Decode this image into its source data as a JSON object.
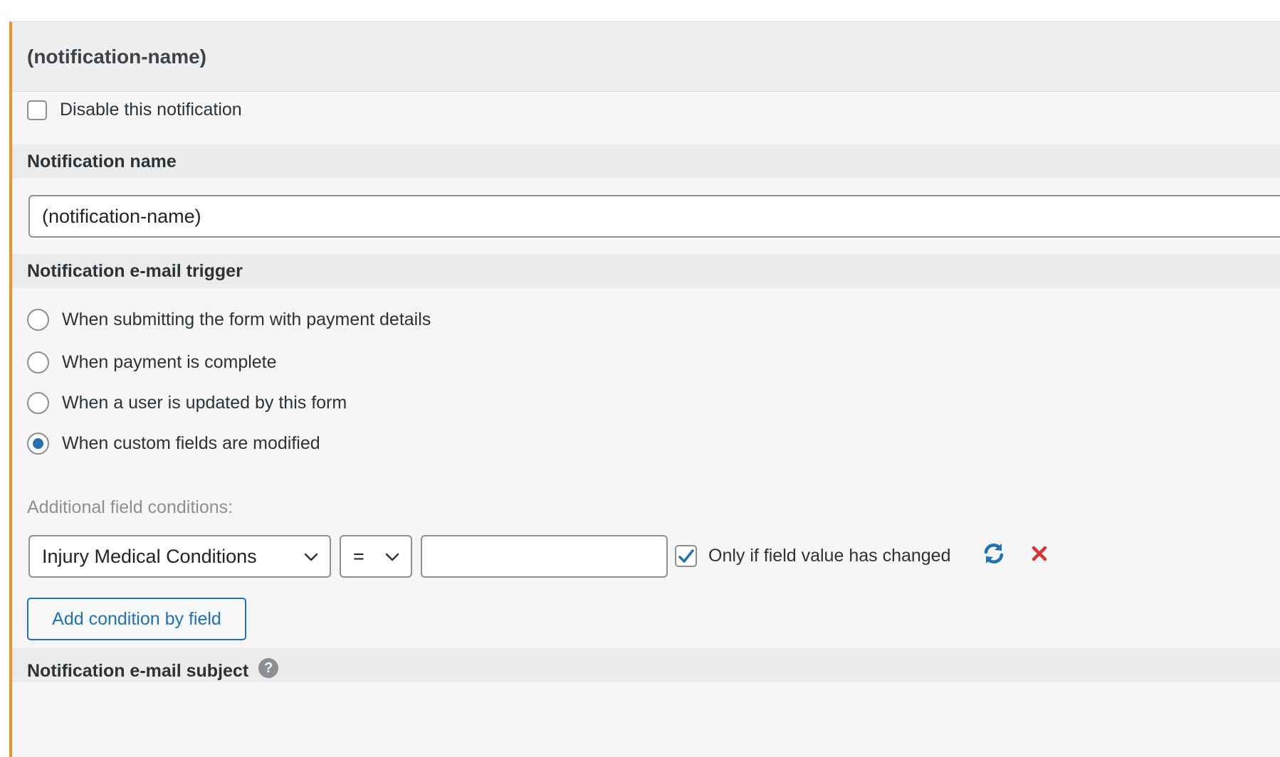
{
  "panel": {
    "title": "(notification-name)",
    "accent_color": "#f0932b"
  },
  "disable": {
    "label": "Disable this notification",
    "checked": false
  },
  "name_section": {
    "heading": "Notification name",
    "value": "(notification-name)"
  },
  "trigger_section": {
    "heading": "Notification e-mail trigger",
    "options": [
      {
        "label": "When submitting the form with payment details",
        "selected": false
      },
      {
        "label": "When payment is complete",
        "selected": false
      },
      {
        "label": "When a user is updated by this form",
        "selected": false
      },
      {
        "label": "When custom fields are modified",
        "selected": true
      }
    ]
  },
  "conditions": {
    "label": "Additional field conditions:",
    "field_select": "Injury Medical Conditions",
    "operator_select": "=",
    "value": "",
    "only_changed_label": "Only if field value has changed",
    "only_changed_checked": true,
    "refresh_icon": "refresh-icon",
    "delete_icon": "close-icon",
    "add_button": "Add condition by field"
  },
  "next_section": {
    "heading": "Notification e-mail subject",
    "help_icon": "?"
  }
}
